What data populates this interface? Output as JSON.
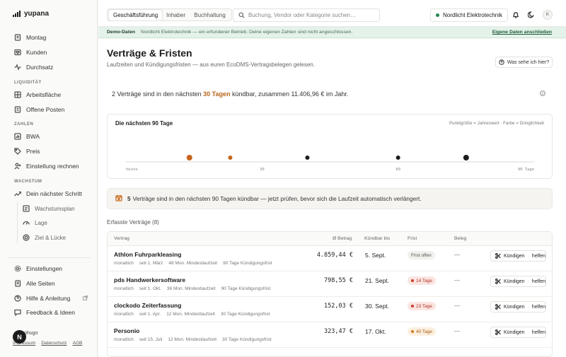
{
  "app": {
    "name": "yupana"
  },
  "sidebar": {
    "items_top": [
      {
        "label": "Montag",
        "icon": "notebook-icon"
      },
      {
        "label": "Kunden",
        "icon": "heart-icon"
      },
      {
        "label": "Durchsatz",
        "icon": "pulse-icon"
      }
    ],
    "sec_liquiditaet": "LIQUIDITÄT",
    "items_liq": [
      {
        "label": "Arbeitsfläche",
        "icon": "grid-icon"
      },
      {
        "label": "Offene Posten",
        "icon": "list-icon"
      }
    ],
    "sec_zahlen": "ZAHLEN",
    "items_zahlen": [
      {
        "label": "BWA",
        "icon": "chart-icon"
      },
      {
        "label": "Preis",
        "icon": "tag-icon"
      },
      {
        "label": "Einstellung rechnen",
        "icon": "user-plus-icon"
      }
    ],
    "sec_wachstum": "WACHSTUM",
    "items_wachstum": [
      {
        "label": "Dein nächster Schritt",
        "icon": "trend-icon"
      },
      {
        "label": "Wachstumsplan",
        "icon": "map-icon"
      },
      {
        "label": "Lage",
        "icon": "gauge-icon"
      },
      {
        "label": "Ziel & Lücke",
        "icon": "target-icon"
      }
    ],
    "items_bottom": [
      {
        "label": "Einstellungen",
        "icon": "gear-icon"
      },
      {
        "label": "Alle Seiten",
        "icon": "pages-icon"
      },
      {
        "label": "Hilfe & Anleitung",
        "icon": "help-icon"
      },
      {
        "label": "Feedback & Ideen",
        "icon": "chat-icon"
      }
    ],
    "user": "ohugo",
    "avatar_letter": "N",
    "links": [
      "Impressum",
      "Datenschutz",
      "AGB"
    ]
  },
  "topbar": {
    "tabs": [
      {
        "label": "Geschäftsführung",
        "active": true
      },
      {
        "label": "Inhaber",
        "active": false
      },
      {
        "label": "Buchhaltung",
        "active": false
      }
    ],
    "search_placeholder": "Buchung, Vendor oder Kategorie suchen…",
    "company": "Nordlicht Elektrotechnik",
    "user_initial": "K"
  },
  "demo": {
    "label": "Demo-Daten",
    "text": "Nordlicht Elektrotechnik — ein erfundener Betrieb. Deine eigenen Zahlen sind nicht angeschlossen.",
    "link": "Eigene Daten anschließen"
  },
  "page": {
    "title": "Verträge & Fristen",
    "subtitle": "Laufzeiten und Kündigungsfristen — aus euren EcoDMS-Vertragsbelegen gelesen.",
    "help_button": "Was sehe ich hier?",
    "headline_pre": "2 Verträge sind in den nächsten",
    "headline_days": "30 Tagen",
    "headline_post": "kündbar, zusammen 11.406,96 € im Jahr."
  },
  "chart_data": {
    "type": "scatter",
    "title": "Die nächsten 90 Tage",
    "legend_note": "Punktgröße = Jahreswert · Farbe = Dringlichkeit",
    "xlim": [
      0,
      90
    ],
    "tick_labels": [
      {
        "x": 0,
        "label": "heute"
      },
      {
        "x": 30,
        "label": "30"
      },
      {
        "x": 60,
        "label": "60"
      },
      {
        "x": 90,
        "label": "90 Tage"
      }
    ],
    "points": [
      {
        "x": 14,
        "size": 4,
        "color": "#c8641d"
      },
      {
        "x": 23,
        "size": 3,
        "color": "#c8641d"
      },
      {
        "x": 40,
        "size": 3,
        "color": "#1c1c1c"
      },
      {
        "x": 60,
        "size": 3,
        "color": "#1c1c1c"
      },
      {
        "x": 75,
        "size": 4,
        "color": "#1c1c1c"
      }
    ]
  },
  "alert": {
    "count": "5",
    "text": "Verträge sind in den nächsten 90 Tagen kündbar — jetzt prüfen, bevor sich die Laufzeit automatisch verlängert."
  },
  "table": {
    "section_title": "Erfasste Verträge (8)",
    "headers": [
      "Vertrag",
      "Ø Betrag",
      "Kündbar bis",
      "Frist",
      "Beleg"
    ],
    "button_label": "Kündigen",
    "button_help": "helfen",
    "rows": [
      {
        "name": "Athlon Fuhrparkleasing",
        "interval": "monatlich",
        "since": "seit 1. März",
        "term": "48 Mon. Mindestlaufzeit",
        "notice": "90 Tage Kündigungsfrist",
        "amount": "4.859,44 €",
        "date": "5. Sept.",
        "badge": "Frist offen",
        "badge_type": "neutral",
        "beleg": "—"
      },
      {
        "name": "pds Handwerkersoftware",
        "interval": "monatlich",
        "since": "seit 1. Okt.",
        "term": "36 Mon. Mindestlaufzeit",
        "notice": "90 Tage Kündigungsfrist",
        "amount": "798,55 €",
        "date": "21. Sept.",
        "badge": "14 Tage",
        "badge_type": "red",
        "beleg": "—"
      },
      {
        "name": "clockodo Zeiterfassung",
        "interval": "monatlich",
        "since": "seit 1. Apr.",
        "term": "12 Mon. Mindestlaufzeit",
        "notice": "30 Tage Kündigungsfrist",
        "amount": "152,03 €",
        "date": "30. Sept.",
        "badge": "23 Tage",
        "badge_type": "red",
        "beleg": "—"
      },
      {
        "name": "Personio",
        "interval": "monatlich",
        "since": "seit 15. Juli",
        "term": "12 Mon. Mindestlaufzeit",
        "notice": "30 Tage Kündigungsfrist",
        "amount": "323,47 €",
        "date": "17. Okt.",
        "badge": "40 Tage",
        "badge_type": "orange",
        "beleg": "—"
      }
    ]
  }
}
